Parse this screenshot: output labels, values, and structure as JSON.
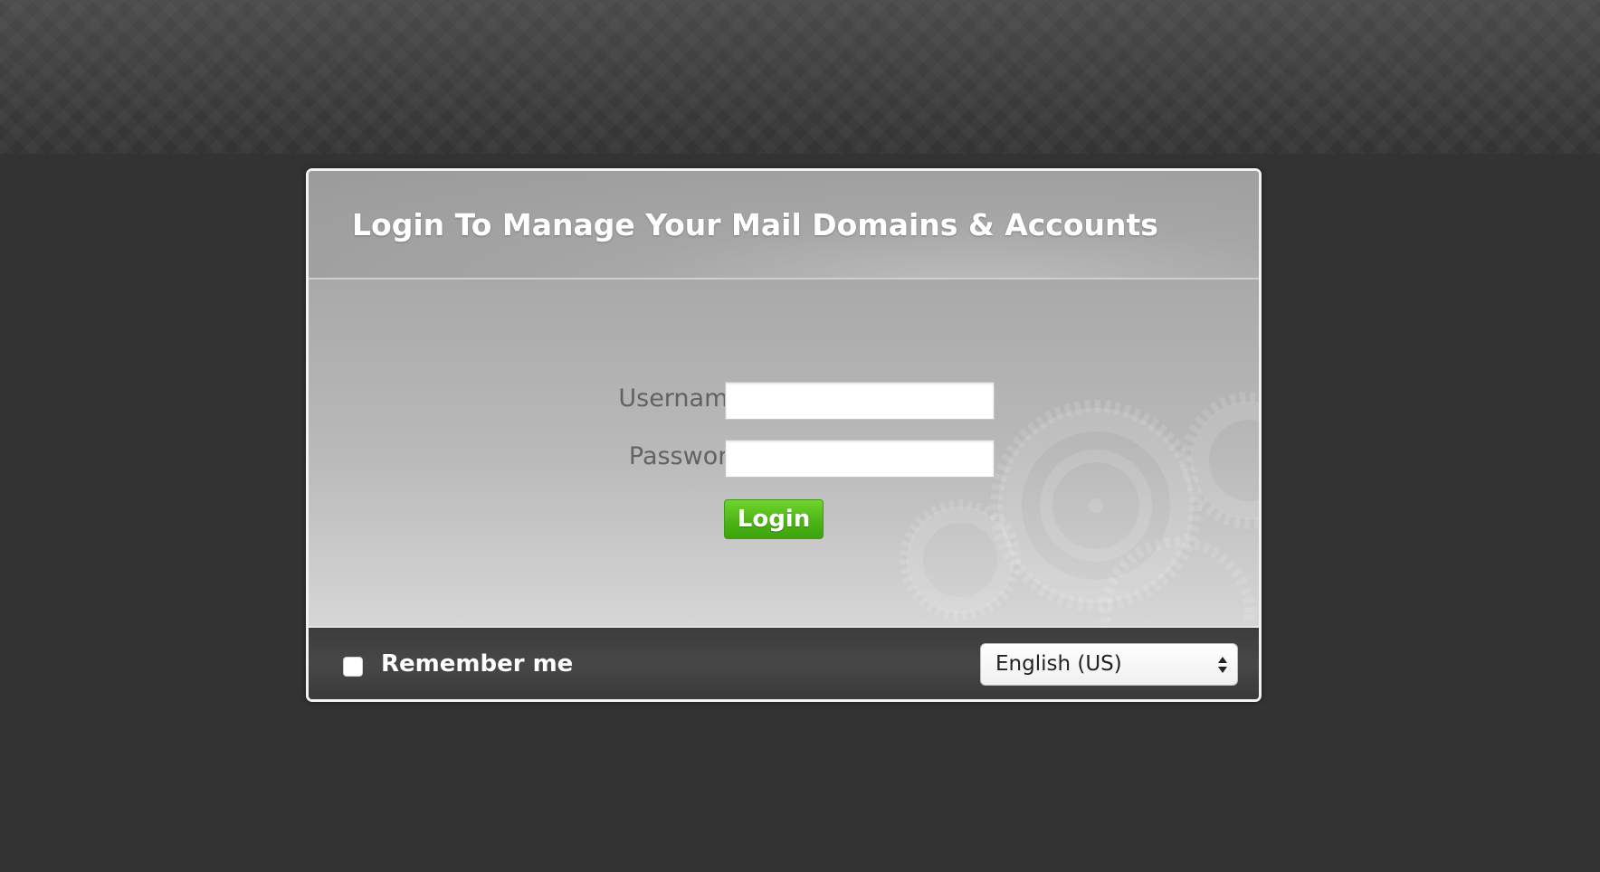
{
  "login_box": {
    "title": "Login To Manage Your Mail Domains & Accounts",
    "username_label": "Username",
    "username_value": "",
    "password_label": "Password",
    "password_value": "",
    "login_button_label": "Login"
  },
  "footer": {
    "remember_label": "Remember me",
    "remember_checked": false,
    "language_selected": "English (US)"
  },
  "colors": {
    "page_background": "#333333",
    "login_button": "#4db516",
    "footer_background": "#424242",
    "header_text": "#ffffff"
  },
  "icons": [
    "gear-decoration",
    "select-arrows-icon"
  ]
}
